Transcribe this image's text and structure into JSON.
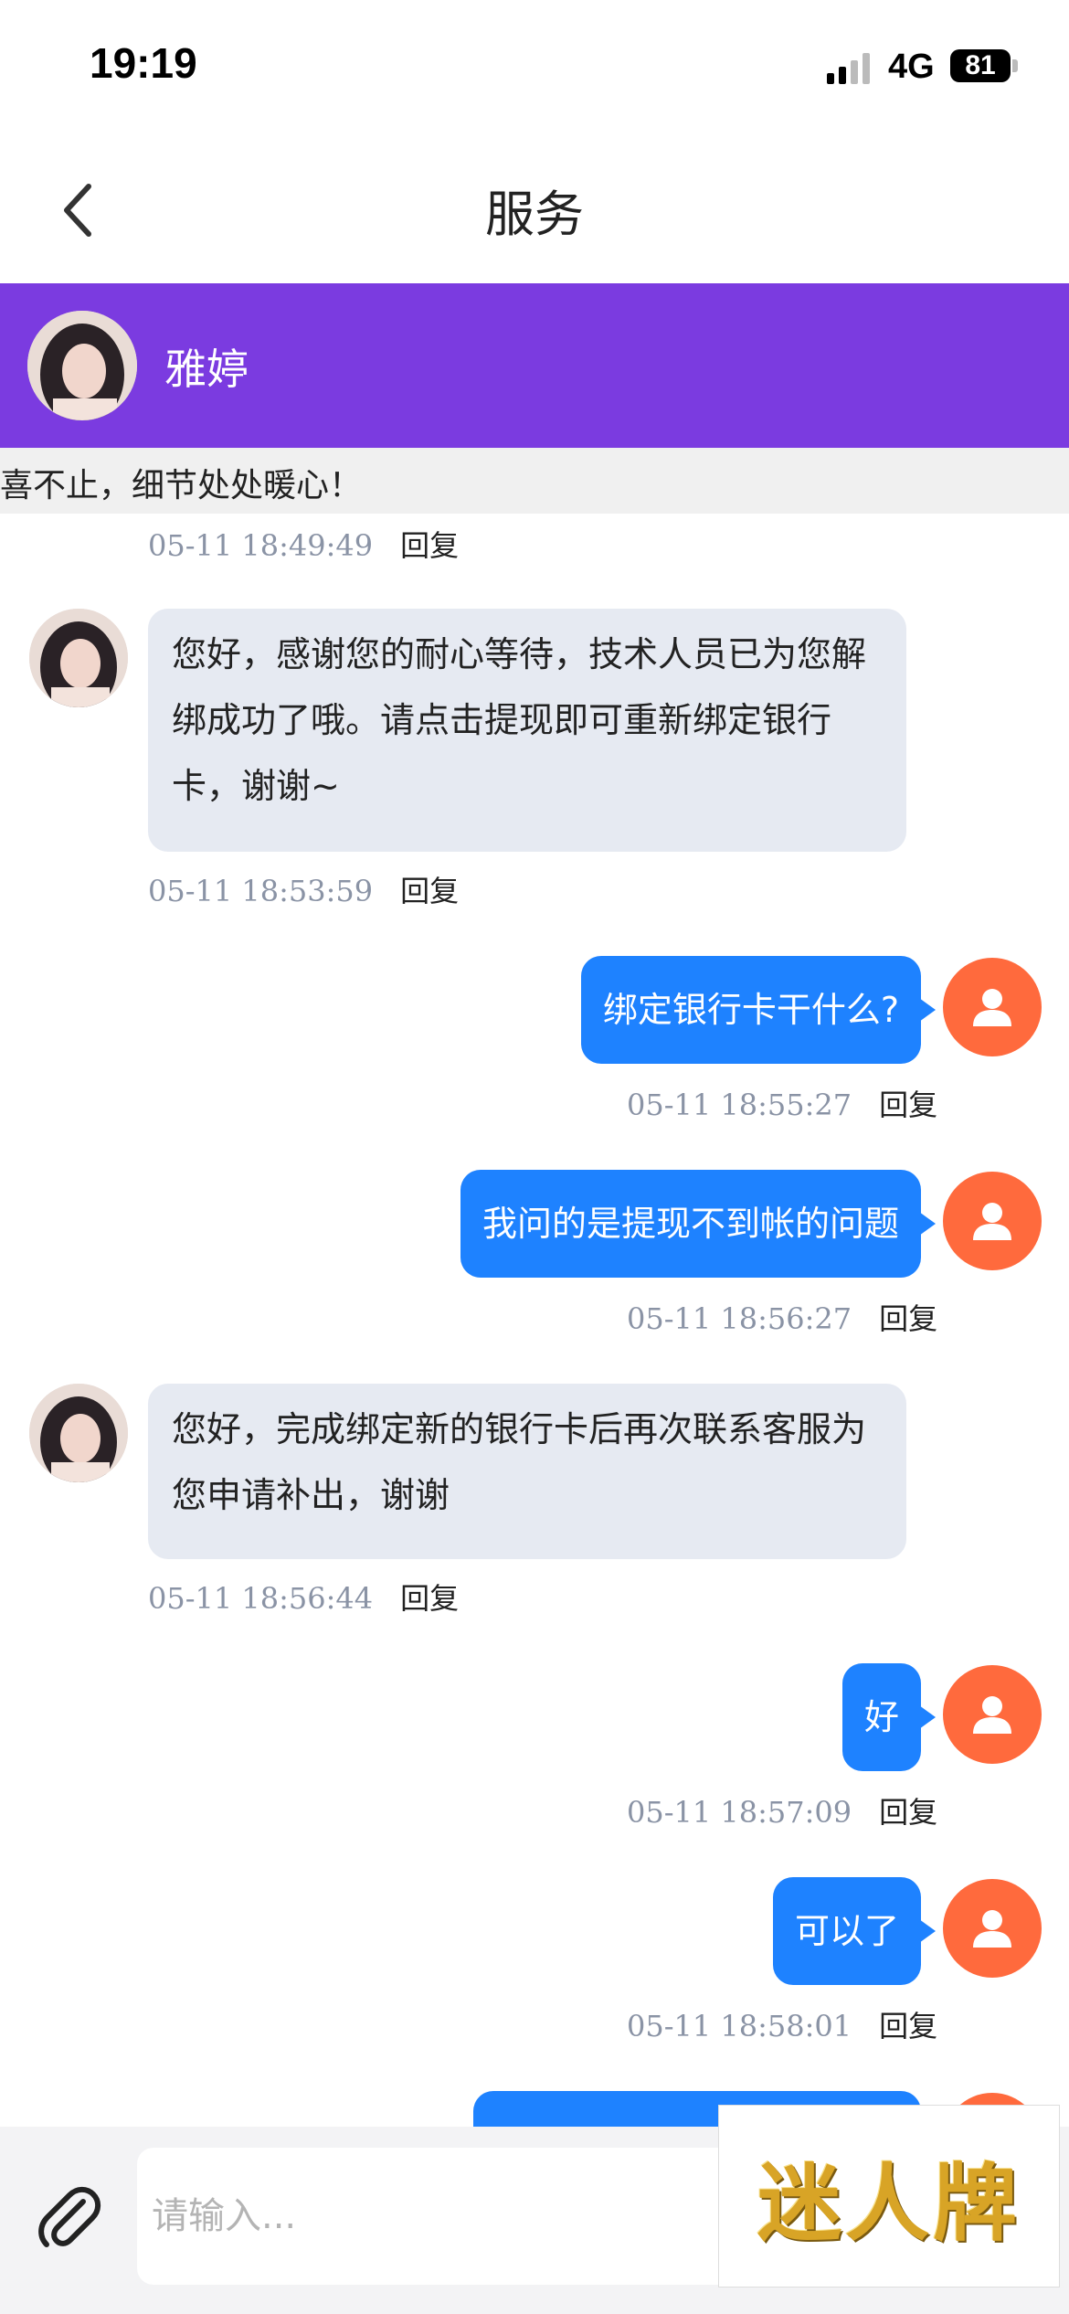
{
  "status": {
    "time": "19:19",
    "network": "4G",
    "battery": "81"
  },
  "nav": {
    "title": "服务",
    "back_icon": "chevron-left-icon"
  },
  "agent": {
    "name": "雅婷"
  },
  "notice": {
    "text": "喜不止，细节处处暖心！"
  },
  "reply_label": "回复",
  "messages": [
    {
      "direction": "in",
      "text": "",
      "time": "05-11 18:49:49"
    },
    {
      "direction": "in",
      "text": "您好，感谢您的耐心等待，技术人员已为您解绑成功了哦。请点击提现即可重新绑定银行卡，谢谢~",
      "time": "05-11 18:53:59"
    },
    {
      "direction": "out",
      "text": "绑定银行卡干什么?",
      "time": "05-11 18:55:27"
    },
    {
      "direction": "out",
      "text": "我问的是提现不到帐的问题",
      "time": "05-11 18:56:27"
    },
    {
      "direction": "in",
      "text": "您好，完成绑定新的银行卡后再次联系客服为您申请补出，谢谢",
      "time": "05-11 18:56:44"
    },
    {
      "direction": "out",
      "text": "好",
      "time": "05-11 18:57:09"
    },
    {
      "direction": "out",
      "text": "可以了",
      "time": "05-11 18:58:01"
    }
  ],
  "input": {
    "placeholder": "请输入..."
  },
  "watermark": {
    "text": "迷人牌"
  },
  "colors": {
    "header_purple": "#7b3be0",
    "bubble_blue": "#1e82ff",
    "user_avatar_orange": "#ff6a3d",
    "bubble_grey": "#e6eaf2"
  }
}
